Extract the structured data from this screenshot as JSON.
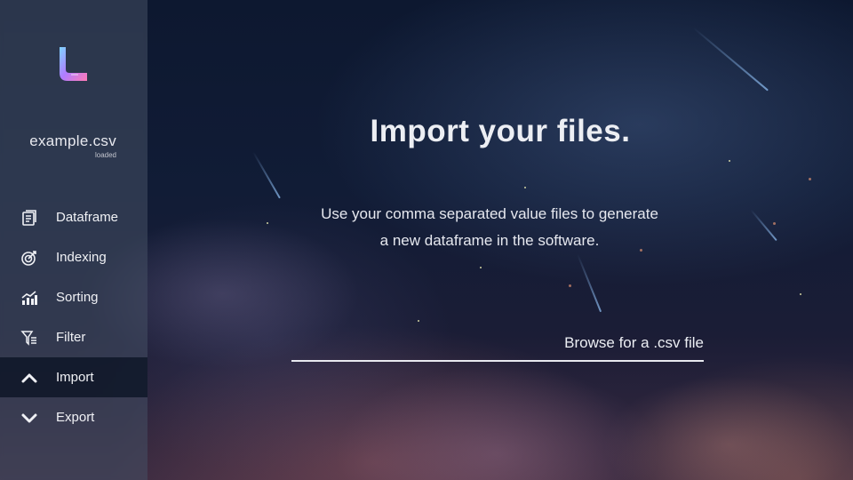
{
  "app": {
    "accent_gradient": [
      "#7fd3ff",
      "#d36bff",
      "#ff7ab6"
    ]
  },
  "sidebar": {
    "file_name": "example.csv",
    "file_status": "loaded",
    "items": [
      {
        "label": "Dataframe",
        "icon": "dataframe-icon"
      },
      {
        "label": "Indexing",
        "icon": "target-icon"
      },
      {
        "label": "Sorting",
        "icon": "bar-chart-trend-icon"
      },
      {
        "label": "Filter",
        "icon": "filter-list-icon"
      },
      {
        "label": "Import",
        "icon": "chevron-up-icon",
        "active": true
      },
      {
        "label": "Export",
        "icon": "chevron-down-icon"
      }
    ]
  },
  "main": {
    "title": "Import your files.",
    "description_line1": "Use your comma separated value files to generate",
    "description_line2": "a new dataframe in the software.",
    "browse_label": "Browse for a .csv file"
  }
}
